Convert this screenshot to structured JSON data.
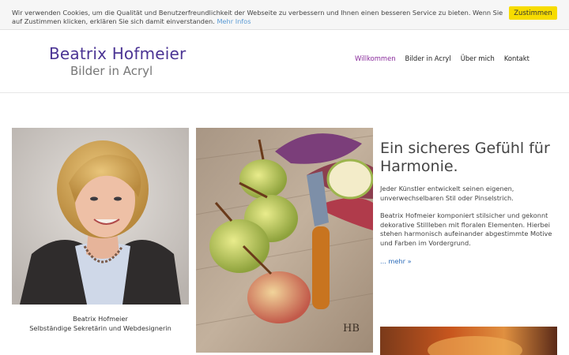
{
  "cookie": {
    "text": "Wir verwenden Cookies, um die Qualität und Benutzerfreundlichkeit der Webseite zu verbessern und Ihnen einen besseren Service zu bieten. Wenn Sie auf Zustimmen klicken, erklären Sie sich damit einverstanden.",
    "link": "Mehr Infos",
    "button": "Zustimmen"
  },
  "logo": {
    "name": "Beatrix Hofmeier",
    "subtitle": "Bilder in Acryl"
  },
  "nav": {
    "items": [
      "Willkommen",
      "Bilder in Acryl",
      "Über mich",
      "Kontakt"
    ]
  },
  "portrait": {
    "caption_name": "Beatrix Hofmeier",
    "caption_role": "Selbständige Sekretärin und Webdesignerin"
  },
  "painting": {
    "signature": "HB"
  },
  "content": {
    "headline": "Ein sicheres Gefühl für Harmonie.",
    "para1": "Jeder Künstler entwickelt seinen eigenen, unverwechselbaren Stil oder Pinselstrich.",
    "para2": "Beatrix Hofmeier komponiert stilsicher und gekonnt dekorative Stillleben mit floralen Elementen. Hierbei stehen harmonisch aufeinander abgestimmte Motive und Farben im Vordergrund.",
    "more": "... mehr »"
  },
  "colors": {
    "accent": "#4b3494",
    "nav_active": "#8a2c9c",
    "cookie_button": "#f7dc00",
    "link": "#2a6ab8"
  }
}
